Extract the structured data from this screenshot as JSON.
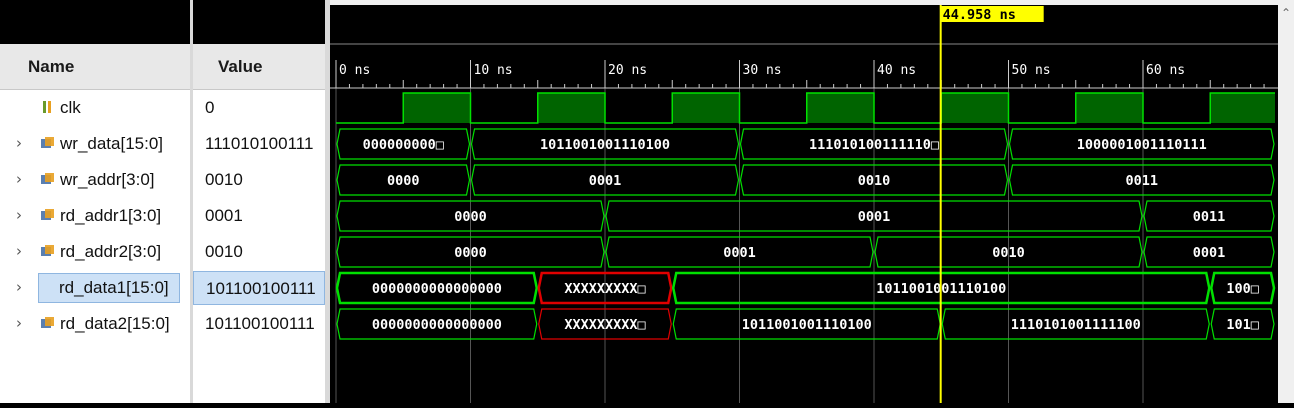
{
  "columns": {
    "name": "Name",
    "value": "Value"
  },
  "cursor": {
    "label": "44.958 ns",
    "time_ns": 44.958
  },
  "timeline": {
    "ticks": [
      "0 ns",
      "10 ns",
      "20 ns",
      "30 ns",
      "40 ns",
      "50 ns",
      "60 ns"
    ]
  },
  "signals": [
    {
      "name": "clk",
      "value": "0",
      "type": "bit",
      "expandable": false,
      "selected": false,
      "icon": "bit-signal-icon"
    },
    {
      "name": "wr_data[15:0]",
      "value": "111010100111",
      "type": "bus",
      "expandable": true,
      "selected": false,
      "icon": "bus-signal-icon"
    },
    {
      "name": "wr_addr[3:0]",
      "value": "0010",
      "type": "bus",
      "expandable": true,
      "selected": false,
      "icon": "bus-signal-icon"
    },
    {
      "name": "rd_addr1[3:0]",
      "value": "0001",
      "type": "bus",
      "expandable": true,
      "selected": false,
      "icon": "bus-signal-icon"
    },
    {
      "name": "rd_addr2[3:0]",
      "value": "0010",
      "type": "bus",
      "expandable": true,
      "selected": false,
      "icon": "bus-signal-icon"
    },
    {
      "name": "rd_data1[15:0]",
      "value": "101100100111",
      "type": "bus",
      "expandable": true,
      "selected": true,
      "icon": "bus-signal-icon"
    },
    {
      "name": "rd_data2[15:0]",
      "value": "101100100111",
      "type": "bus",
      "expandable": true,
      "selected": false,
      "icon": "bus-signal-icon"
    }
  ],
  "waves": {
    "clk": [
      {
        "t": 0,
        "v": 0
      },
      {
        "t": 5,
        "v": 1
      },
      {
        "t": 10,
        "v": 0
      },
      {
        "t": 15,
        "v": 1
      },
      {
        "t": 20,
        "v": 0
      },
      {
        "t": 25,
        "v": 1
      },
      {
        "t": 30,
        "v": 0
      },
      {
        "t": 35,
        "v": 1
      },
      {
        "t": 40,
        "v": 0
      },
      {
        "t": 45,
        "v": 1
      },
      {
        "t": 50,
        "v": 0
      },
      {
        "t": 55,
        "v": 1
      },
      {
        "t": 60,
        "v": 0
      },
      {
        "t": 65,
        "v": 1
      }
    ],
    "wr_data": [
      {
        "t0": 0,
        "t1": 10,
        "label": "000000000□",
        "color": "green"
      },
      {
        "t0": 10,
        "t1": 30,
        "label": "1011001001110100",
        "color": "green"
      },
      {
        "t0": 30,
        "t1": 50,
        "label": "111010100111110□",
        "color": "green"
      },
      {
        "t0": 50,
        "t1": 70,
        "label": "1000001001110111",
        "color": "green"
      }
    ],
    "wr_addr": [
      {
        "t0": 0,
        "t1": 10,
        "label": "0000",
        "color": "green"
      },
      {
        "t0": 10,
        "t1": 30,
        "label": "0001",
        "color": "green"
      },
      {
        "t0": 30,
        "t1": 50,
        "label": "0010",
        "color": "green"
      },
      {
        "t0": 50,
        "t1": 70,
        "label": "0011",
        "color": "green"
      }
    ],
    "rd_addr1": [
      {
        "t0": 0,
        "t1": 20,
        "label": "0000",
        "color": "green"
      },
      {
        "t0": 20,
        "t1": 60,
        "label": "0001",
        "color": "green"
      },
      {
        "t0": 60,
        "t1": 70,
        "label": "0011",
        "color": "green"
      }
    ],
    "rd_addr2": [
      {
        "t0": 0,
        "t1": 20,
        "label": "0000",
        "color": "green"
      },
      {
        "t0": 20,
        "t1": 40,
        "label": "0001",
        "color": "green"
      },
      {
        "t0": 40,
        "t1": 60,
        "label": "0010",
        "color": "green"
      },
      {
        "t0": 60,
        "t1": 70,
        "label": "0001",
        "color": "green"
      }
    ],
    "rd_data1": [
      {
        "t0": 0,
        "t1": 15,
        "label": "0000000000000000",
        "color": "green"
      },
      {
        "t0": 15,
        "t1": 25,
        "label": "XXXXXXXXX□",
        "color": "red"
      },
      {
        "t0": 25,
        "t1": 65,
        "label": "1011001001110100",
        "color": "green"
      },
      {
        "t0": 65,
        "t1": 70,
        "label": "100□",
        "color": "green"
      }
    ],
    "rd_data2": [
      {
        "t0": 0,
        "t1": 15,
        "label": "0000000000000000",
        "color": "green"
      },
      {
        "t0": 15,
        "t1": 25,
        "label": "XXXXXXXXX□",
        "color": "red"
      },
      {
        "t0": 25,
        "t1": 45,
        "label": "1011001001110100",
        "color": "green"
      },
      {
        "t0": 45,
        "t1": 65,
        "label": "1110101001111100",
        "color": "green"
      },
      {
        "t0": 65,
        "t1": 70,
        "label": "101□",
        "color": "green"
      }
    ]
  },
  "colors": {
    "wave": "#00e000",
    "wave_fill": "#006400",
    "error": "#e00000",
    "cursor": "#ffff00",
    "cursor_label_bg": "#ffff00",
    "grid": "#555555",
    "selection": "#cde1f6"
  }
}
